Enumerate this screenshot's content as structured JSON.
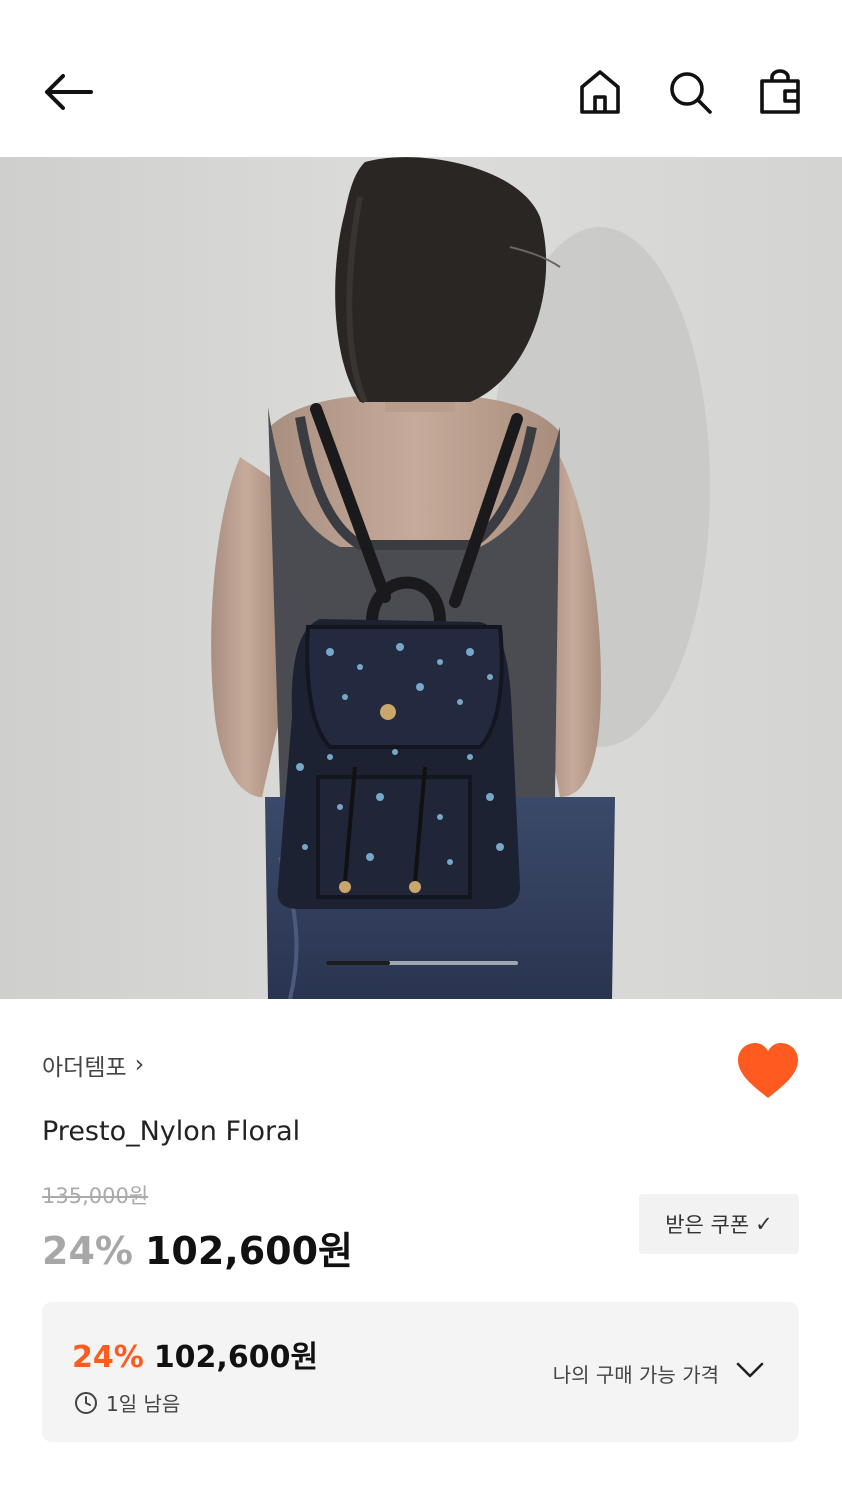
{
  "header": {
    "back_icon": "arrow-left-icon",
    "home_icon": "home-icon",
    "search_icon": "search-icon",
    "bag_icon": "shopping-bag-icon"
  },
  "gallery": {
    "image_description_icon": "product-photo",
    "current_index": 1,
    "total": 3
  },
  "product": {
    "brand": "아더템포",
    "brand_chevron": "›",
    "title": "Presto_Nylon Floral",
    "original_price": "135,000원",
    "discount": "24%",
    "price": "102,600원",
    "liked": true,
    "like_color": "#ff5a1f"
  },
  "coupon": {
    "label": "받은 쿠폰",
    "check": "✓"
  },
  "my_price": {
    "discount": "24%",
    "price": "102,600원",
    "time_left": "1일 남음",
    "label": "나의 구매 가능 가격",
    "accent": "#ff5a1f"
  }
}
